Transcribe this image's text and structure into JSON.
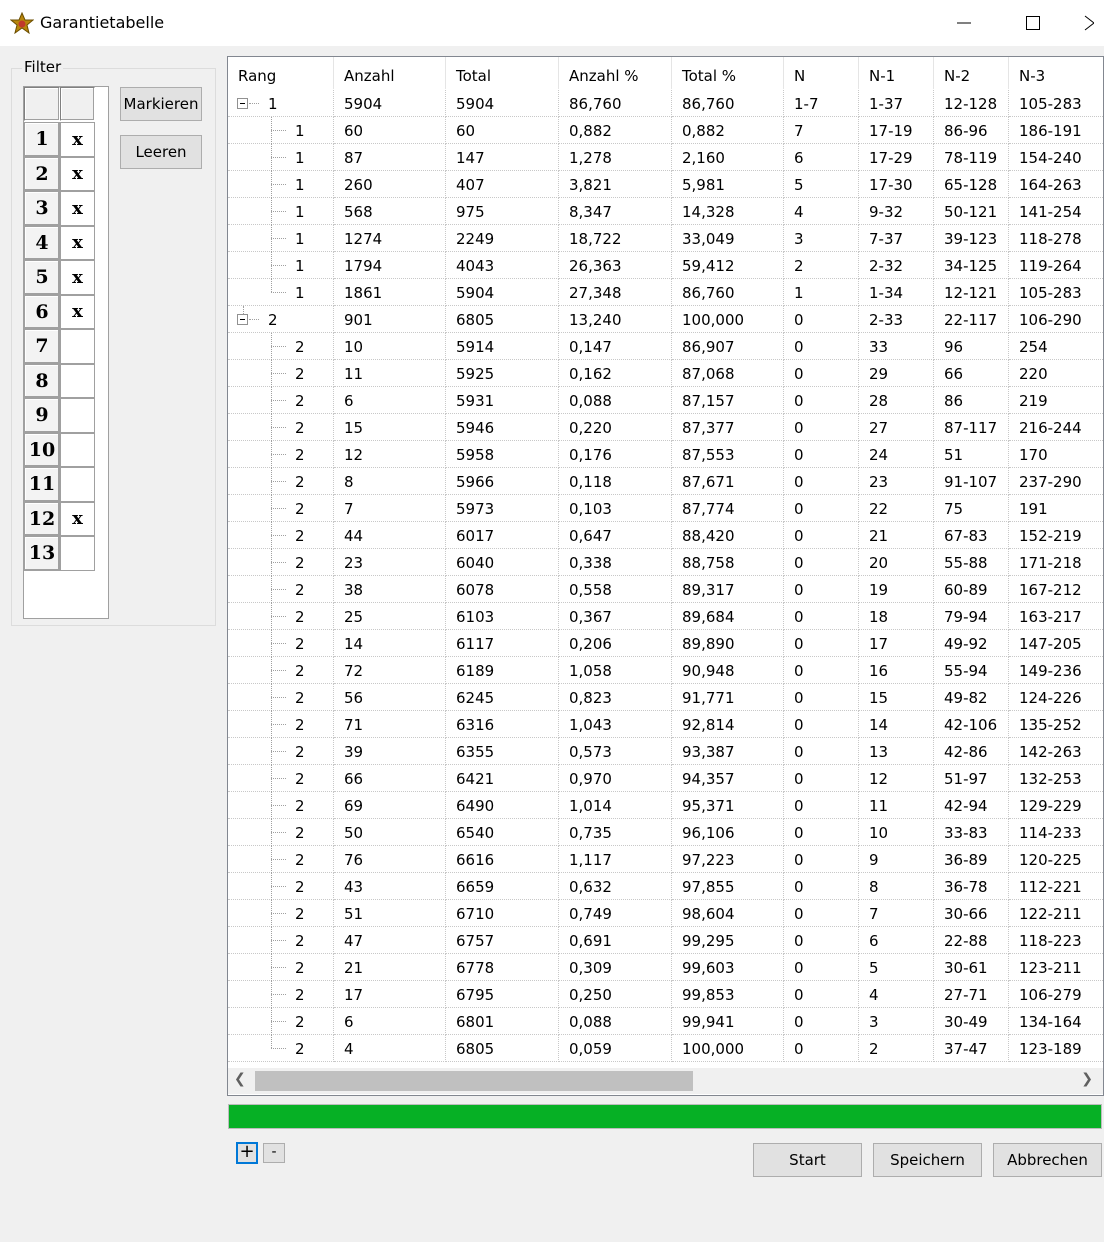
{
  "window": {
    "title": "Garantietabelle",
    "minimize_glyph": "—",
    "maximize_glyph": "☐",
    "close_glyph": "〉"
  },
  "filter": {
    "label": "Filter",
    "mark_label": "Markieren",
    "clear_label": "Leeren",
    "rows": [
      {
        "num": "1",
        "mark": "x"
      },
      {
        "num": "2",
        "mark": "x"
      },
      {
        "num": "3",
        "mark": "x"
      },
      {
        "num": "4",
        "mark": "x"
      },
      {
        "num": "5",
        "mark": "x"
      },
      {
        "num": "6",
        "mark": "x"
      },
      {
        "num": "7",
        "mark": ""
      },
      {
        "num": "8",
        "mark": ""
      },
      {
        "num": "9",
        "mark": ""
      },
      {
        "num": "10",
        "mark": ""
      },
      {
        "num": "11",
        "mark": ""
      },
      {
        "num": "12",
        "mark": "x"
      },
      {
        "num": "13",
        "mark": ""
      }
    ]
  },
  "table": {
    "columns": [
      "Rang",
      "Anzahl",
      "Total",
      "Anzahl %",
      "Total %",
      "N",
      "N-1",
      "N-2",
      "N-3"
    ],
    "rows": [
      {
        "level": 0,
        "rang": "1",
        "anzahl": "5904",
        "total": "5904",
        "anzahl_pct": "86,760",
        "total_pct": "86,760",
        "n": "1-7",
        "n1": "1-37",
        "n2": "12-128",
        "n3": "105-283"
      },
      {
        "level": 1,
        "rang": "1",
        "anzahl": "60",
        "total": "60",
        "anzahl_pct": "0,882",
        "total_pct": "0,882",
        "n": "7",
        "n1": "17-19",
        "n2": "86-96",
        "n3": "186-191"
      },
      {
        "level": 1,
        "rang": "1",
        "anzahl": "87",
        "total": "147",
        "anzahl_pct": "1,278",
        "total_pct": "2,160",
        "n": "6",
        "n1": "17-29",
        "n2": "78-119",
        "n3": "154-240"
      },
      {
        "level": 1,
        "rang": "1",
        "anzahl": "260",
        "total": "407",
        "anzahl_pct": "3,821",
        "total_pct": "5,981",
        "n": "5",
        "n1": "17-30",
        "n2": "65-128",
        "n3": "164-263"
      },
      {
        "level": 1,
        "rang": "1",
        "anzahl": "568",
        "total": "975",
        "anzahl_pct": "8,347",
        "total_pct": "14,328",
        "n": "4",
        "n1": "9-32",
        "n2": "50-121",
        "n3": "141-254"
      },
      {
        "level": 1,
        "rang": "1",
        "anzahl": "1274",
        "total": "2249",
        "anzahl_pct": "18,722",
        "total_pct": "33,049",
        "n": "3",
        "n1": "7-37",
        "n2": "39-123",
        "n3": "118-278"
      },
      {
        "level": 1,
        "rang": "1",
        "anzahl": "1794",
        "total": "4043",
        "anzahl_pct": "26,363",
        "total_pct": "59,412",
        "n": "2",
        "n1": "2-32",
        "n2": "34-125",
        "n3": "119-264"
      },
      {
        "level": 1,
        "rang": "1",
        "anzahl": "1861",
        "total": "5904",
        "anzahl_pct": "27,348",
        "total_pct": "86,760",
        "n": "1",
        "n1": "1-34",
        "n2": "12-121",
        "n3": "105-283"
      },
      {
        "level": 0,
        "rang": "2",
        "anzahl": "901",
        "total": "6805",
        "anzahl_pct": "13,240",
        "total_pct": "100,000",
        "n": "0",
        "n1": "2-33",
        "n2": "22-117",
        "n3": "106-290"
      },
      {
        "level": 1,
        "rang": "2",
        "anzahl": "10",
        "total": "5914",
        "anzahl_pct": "0,147",
        "total_pct": "86,907",
        "n": "0",
        "n1": "33",
        "n2": "96",
        "n3": "254"
      },
      {
        "level": 1,
        "rang": "2",
        "anzahl": "11",
        "total": "5925",
        "anzahl_pct": "0,162",
        "total_pct": "87,068",
        "n": "0",
        "n1": "29",
        "n2": "66",
        "n3": "220"
      },
      {
        "level": 1,
        "rang": "2",
        "anzahl": "6",
        "total": "5931",
        "anzahl_pct": "0,088",
        "total_pct": "87,157",
        "n": "0",
        "n1": "28",
        "n2": "86",
        "n3": "219"
      },
      {
        "level": 1,
        "rang": "2",
        "anzahl": "15",
        "total": "5946",
        "anzahl_pct": "0,220",
        "total_pct": "87,377",
        "n": "0",
        "n1": "27",
        "n2": "87-117",
        "n3": "216-244"
      },
      {
        "level": 1,
        "rang": "2",
        "anzahl": "12",
        "total": "5958",
        "anzahl_pct": "0,176",
        "total_pct": "87,553",
        "n": "0",
        "n1": "24",
        "n2": "51",
        "n3": "170"
      },
      {
        "level": 1,
        "rang": "2",
        "anzahl": "8",
        "total": "5966",
        "anzahl_pct": "0,118",
        "total_pct": "87,671",
        "n": "0",
        "n1": "23",
        "n2": "91-107",
        "n3": "237-290"
      },
      {
        "level": 1,
        "rang": "2",
        "anzahl": "7",
        "total": "5973",
        "anzahl_pct": "0,103",
        "total_pct": "87,774",
        "n": "0",
        "n1": "22",
        "n2": "75",
        "n3": "191"
      },
      {
        "level": 1,
        "rang": "2",
        "anzahl": "44",
        "total": "6017",
        "anzahl_pct": "0,647",
        "total_pct": "88,420",
        "n": "0",
        "n1": "21",
        "n2": "67-83",
        "n3": "152-219"
      },
      {
        "level": 1,
        "rang": "2",
        "anzahl": "23",
        "total": "6040",
        "anzahl_pct": "0,338",
        "total_pct": "88,758",
        "n": "0",
        "n1": "20",
        "n2": "55-88",
        "n3": "171-218"
      },
      {
        "level": 1,
        "rang": "2",
        "anzahl": "38",
        "total": "6078",
        "anzahl_pct": "0,558",
        "total_pct": "89,317",
        "n": "0",
        "n1": "19",
        "n2": "60-89",
        "n3": "167-212"
      },
      {
        "level": 1,
        "rang": "2",
        "anzahl": "25",
        "total": "6103",
        "anzahl_pct": "0,367",
        "total_pct": "89,684",
        "n": "0",
        "n1": "18",
        "n2": "79-94",
        "n3": "163-217"
      },
      {
        "level": 1,
        "rang": "2",
        "anzahl": "14",
        "total": "6117",
        "anzahl_pct": "0,206",
        "total_pct": "89,890",
        "n": "0",
        "n1": "17",
        "n2": "49-92",
        "n3": "147-205"
      },
      {
        "level": 1,
        "rang": "2",
        "anzahl": "72",
        "total": "6189",
        "anzahl_pct": "1,058",
        "total_pct": "90,948",
        "n": "0",
        "n1": "16",
        "n2": "55-94",
        "n3": "149-236"
      },
      {
        "level": 1,
        "rang": "2",
        "anzahl": "56",
        "total": "6245",
        "anzahl_pct": "0,823",
        "total_pct": "91,771",
        "n": "0",
        "n1": "15",
        "n2": "49-82",
        "n3": "124-226"
      },
      {
        "level": 1,
        "rang": "2",
        "anzahl": "71",
        "total": "6316",
        "anzahl_pct": "1,043",
        "total_pct": "92,814",
        "n": "0",
        "n1": "14",
        "n2": "42-106",
        "n3": "135-252"
      },
      {
        "level": 1,
        "rang": "2",
        "anzahl": "39",
        "total": "6355",
        "anzahl_pct": "0,573",
        "total_pct": "93,387",
        "n": "0",
        "n1": "13",
        "n2": "42-86",
        "n3": "142-263"
      },
      {
        "level": 1,
        "rang": "2",
        "anzahl": "66",
        "total": "6421",
        "anzahl_pct": "0,970",
        "total_pct": "94,357",
        "n": "0",
        "n1": "12",
        "n2": "51-97",
        "n3": "132-253"
      },
      {
        "level": 1,
        "rang": "2",
        "anzahl": "69",
        "total": "6490",
        "anzahl_pct": "1,014",
        "total_pct": "95,371",
        "n": "0",
        "n1": "11",
        "n2": "42-94",
        "n3": "129-229"
      },
      {
        "level": 1,
        "rang": "2",
        "anzahl": "50",
        "total": "6540",
        "anzahl_pct": "0,735",
        "total_pct": "96,106",
        "n": "0",
        "n1": "10",
        "n2": "33-83",
        "n3": "114-233"
      },
      {
        "level": 1,
        "rang": "2",
        "anzahl": "76",
        "total": "6616",
        "anzahl_pct": "1,117",
        "total_pct": "97,223",
        "n": "0",
        "n1": "9",
        "n2": "36-89",
        "n3": "120-225"
      },
      {
        "level": 1,
        "rang": "2",
        "anzahl": "43",
        "total": "6659",
        "anzahl_pct": "0,632",
        "total_pct": "97,855",
        "n": "0",
        "n1": "8",
        "n2": "36-78",
        "n3": "112-221"
      },
      {
        "level": 1,
        "rang": "2",
        "anzahl": "51",
        "total": "6710",
        "anzahl_pct": "0,749",
        "total_pct": "98,604",
        "n": "0",
        "n1": "7",
        "n2": "30-66",
        "n3": "122-211"
      },
      {
        "level": 1,
        "rang": "2",
        "anzahl": "47",
        "total": "6757",
        "anzahl_pct": "0,691",
        "total_pct": "99,295",
        "n": "0",
        "n1": "6",
        "n2": "22-88",
        "n3": "118-223"
      },
      {
        "level": 1,
        "rang": "2",
        "anzahl": "21",
        "total": "6778",
        "anzahl_pct": "0,309",
        "total_pct": "99,603",
        "n": "0",
        "n1": "5",
        "n2": "30-61",
        "n3": "123-211"
      },
      {
        "level": 1,
        "rang": "2",
        "anzahl": "17",
        "total": "6795",
        "anzahl_pct": "0,250",
        "total_pct": "99,853",
        "n": "0",
        "n1": "4",
        "n2": "27-71",
        "n3": "106-279"
      },
      {
        "level": 1,
        "rang": "2",
        "anzahl": "6",
        "total": "6801",
        "anzahl_pct": "0,088",
        "total_pct": "99,941",
        "n": "0",
        "n1": "3",
        "n2": "30-49",
        "n3": "134-164"
      },
      {
        "level": 1,
        "rang": "2",
        "anzahl": "4",
        "total": "6805",
        "anzahl_pct": "0,059",
        "total_pct": "100,000",
        "n": "0",
        "n1": "2",
        "n2": "37-47",
        "n3": "123-189"
      }
    ]
  },
  "progress": {
    "fraction": 1.0,
    "color": "#06b025"
  },
  "footer": {
    "expand_label": "+",
    "collapse_label": "-",
    "start_label": "Start",
    "save_label": "Speichern",
    "cancel_label": "Abbrechen"
  },
  "scrollbar": {
    "left_glyph": "❮",
    "right_glyph": "❯"
  },
  "icons": {
    "app": "lottery-star-icon"
  }
}
